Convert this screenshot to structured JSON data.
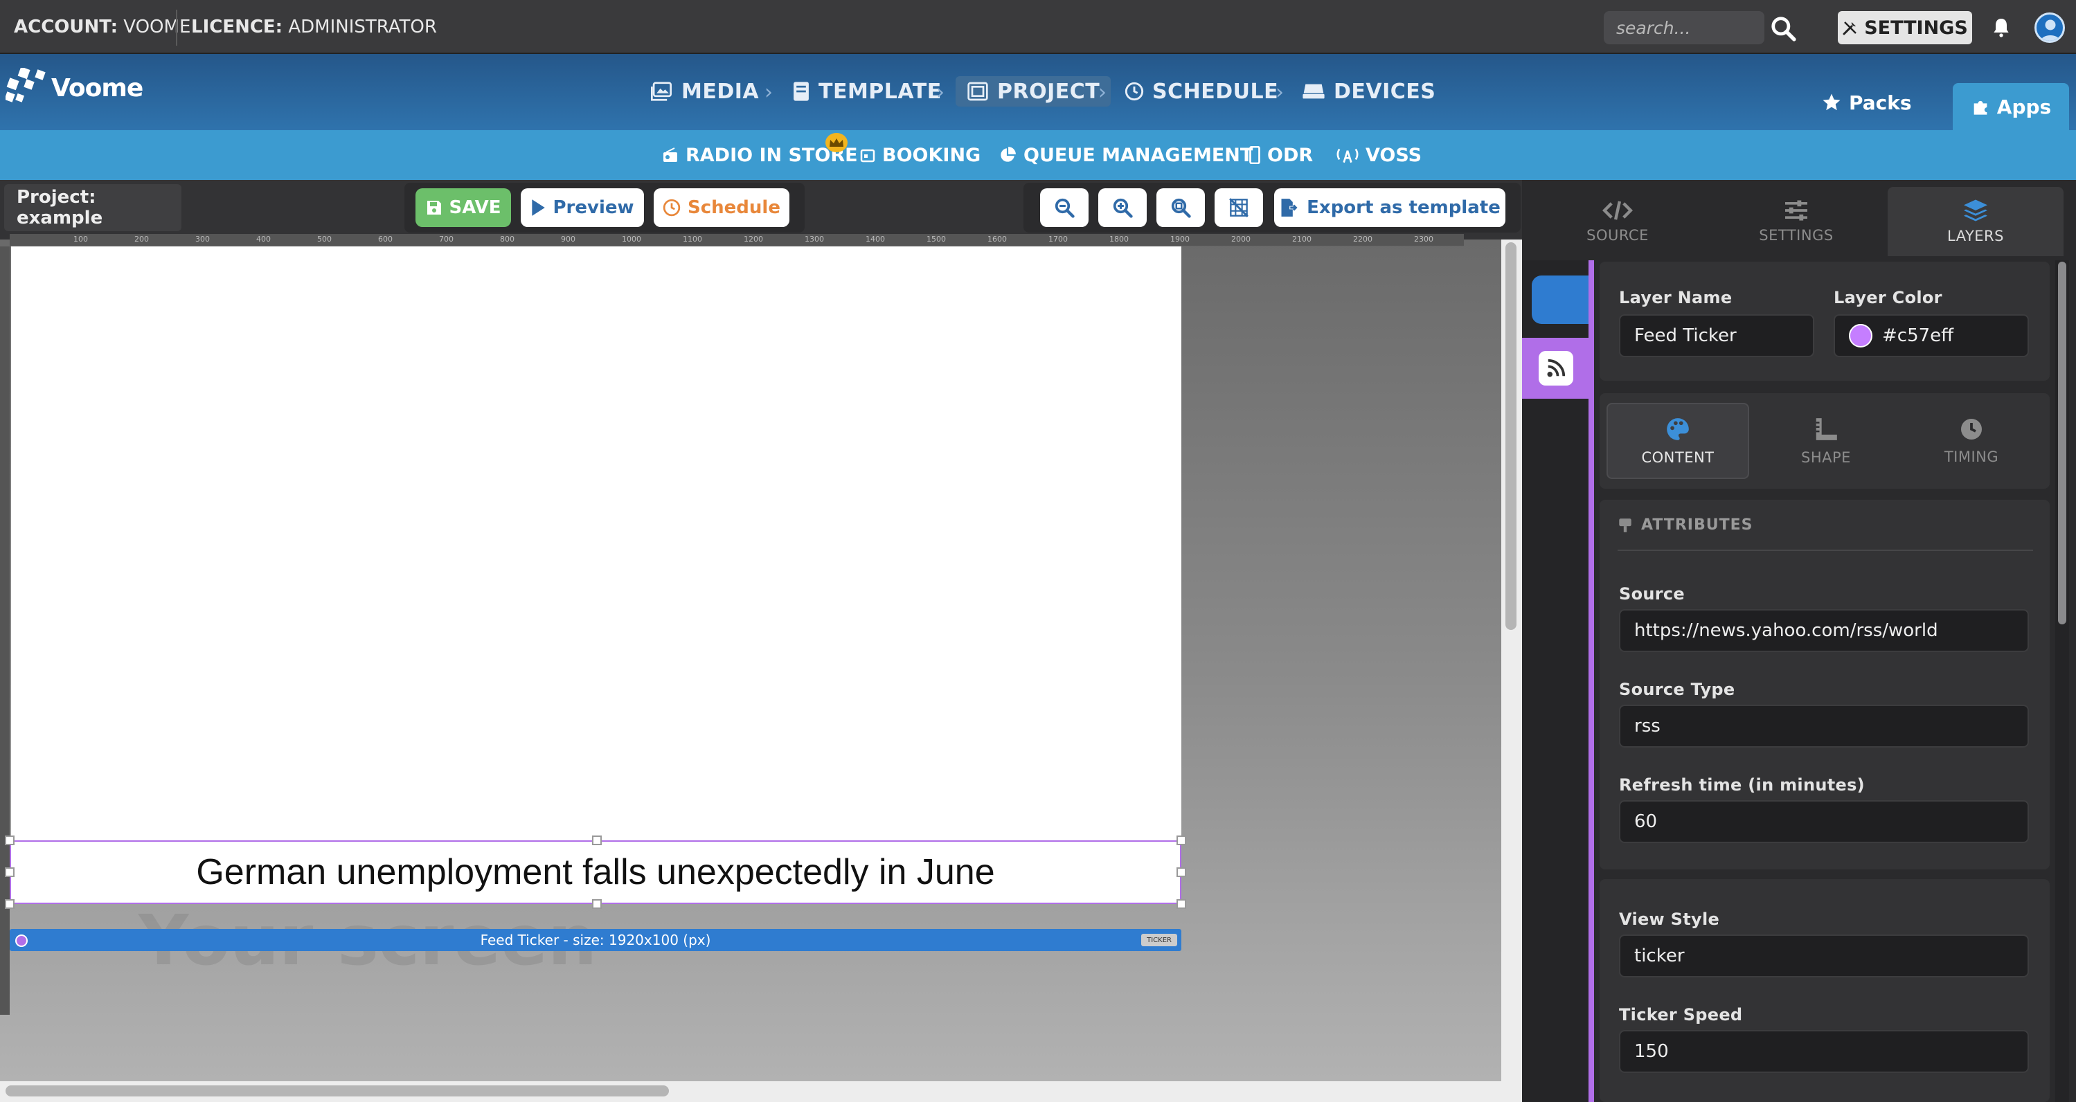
{
  "topbar": {
    "account_label": "ACCOUNT:",
    "account_value": "VOOME",
    "licence_label": "LICENCE:",
    "licence_value": "ADMINISTRATOR",
    "search_placeholder": "search...",
    "settings_label": "SETTINGS"
  },
  "nav": {
    "logo": "Voome",
    "items": [
      "MEDIA",
      "TEMPLATE",
      "PROJECT",
      "SCHEDULE",
      "DEVICES"
    ],
    "active": "PROJECT",
    "packs_label": "Packs",
    "apps_label": "Apps"
  },
  "subnav": {
    "items": [
      "RADIO IN STORE",
      "BOOKING",
      "QUEUE MANAGEMENT",
      "ODR",
      "VOSS"
    ]
  },
  "toolbar": {
    "project_label": "Project: example",
    "save_label": "SAVE",
    "preview_label": "Preview",
    "schedule_label": "Schedule",
    "export_label": "Export as template"
  },
  "canvas": {
    "ruler_ticks": [
      "100",
      "200",
      "300",
      "400",
      "500",
      "600",
      "700",
      "800",
      "900",
      "1000",
      "1100",
      "1200",
      "1300",
      "1400",
      "1500",
      "1600",
      "1700",
      "1800",
      "1900",
      "2000",
      "2100",
      "2200",
      "2300"
    ],
    "ticker_text": "German unemployment falls unexpectedly in June",
    "watermark": "Your screen",
    "layer_bar_label": "Feed Ticker - size: 1920x100 (px)",
    "layer_bar_tag": "TICKER"
  },
  "right_panel": {
    "tabs": [
      "SOURCE",
      "SETTINGS",
      "LAYERS"
    ],
    "active_tab": "LAYERS",
    "layer_name_label": "Layer Name",
    "layer_name_value": "Feed Ticker",
    "layer_color_label": "Layer Color",
    "layer_color_value": "#c57eff",
    "sub_tabs": [
      "CONTENT",
      "SHAPE",
      "TIMING"
    ],
    "active_sub_tab": "CONTENT",
    "attributes_title": "ATTRIBUTES",
    "source_label": "Source",
    "source_value": "https://news.yahoo.com/rss/world",
    "source_type_label": "Source Type",
    "source_type_value": "rss",
    "refresh_label": "Refresh time (in minutes)",
    "refresh_value": "60",
    "view_style_label": "View Style",
    "view_style_value": "ticker",
    "ticker_speed_label": "Ticker Speed",
    "ticker_speed_value": "150"
  },
  "colors": {
    "layer_color": "#c57eff",
    "accent_blue": "#2f7cd0",
    "save_green": "#6cbf6a",
    "schedule_orange": "#e8873a"
  },
  "icons": [
    "search-icon",
    "tools-icon",
    "bell-icon",
    "avatar-icon",
    "image-icon",
    "template-icon",
    "project-icon",
    "clock-icon",
    "devices-icon",
    "star-icon",
    "puzzle-icon",
    "radio-icon",
    "calendar-icon",
    "pie-icon",
    "phone-icon",
    "antenna-icon",
    "crown-icon",
    "save-icon",
    "play-icon",
    "zoom-out-icon",
    "zoom-in-icon",
    "zoom-fit-icon",
    "grid-off-icon",
    "export-icon",
    "code-icon",
    "sliders-icon",
    "layers-icon",
    "rss-icon",
    "palette-icon",
    "ruler-icon",
    "timer-icon",
    "tag-icon"
  ]
}
